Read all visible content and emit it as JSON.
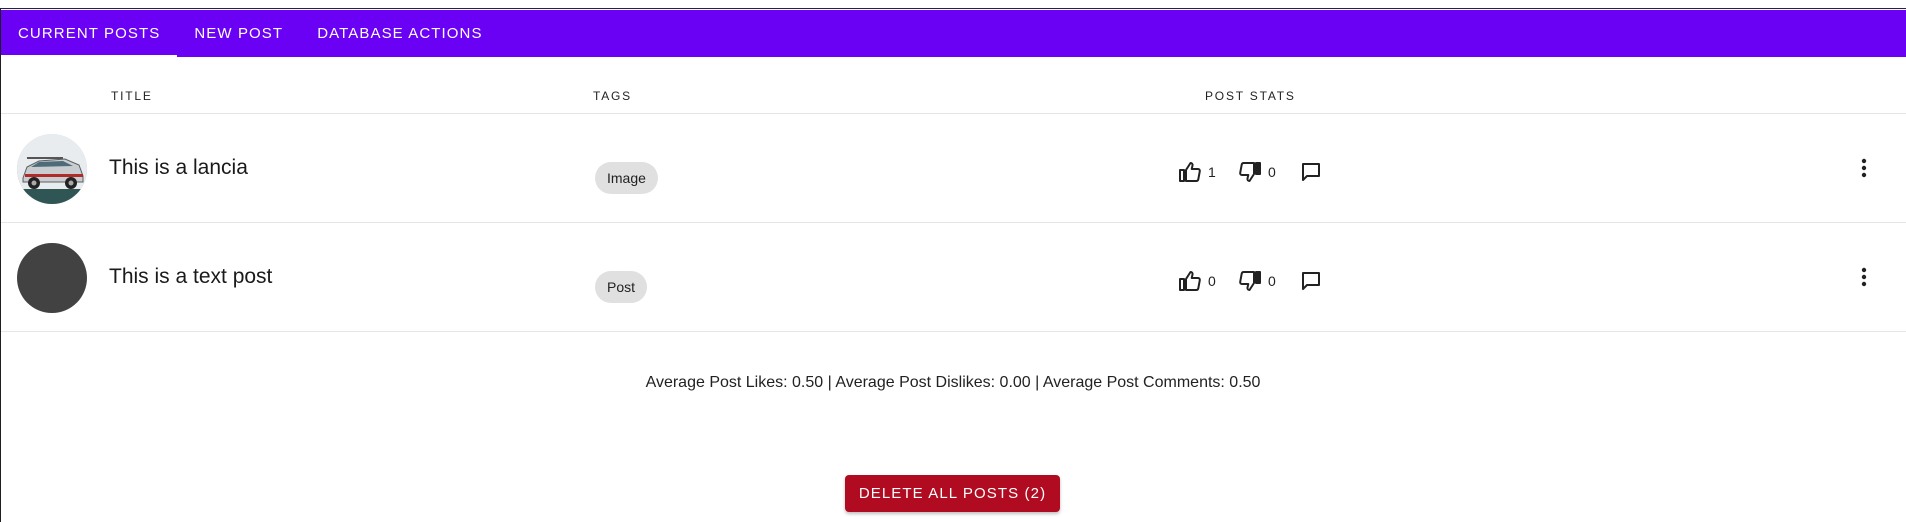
{
  "nav": {
    "tabs": [
      {
        "label": "Current Posts",
        "active": true
      },
      {
        "label": "New Post",
        "active": false
      },
      {
        "label": "Database Actions",
        "active": false
      }
    ]
  },
  "table": {
    "columns": [
      "Title",
      "Tags",
      "Post Stats"
    ],
    "rows": [
      {
        "title": "This is a lancia",
        "tag": "Image",
        "likes": "1",
        "dislikes": "0",
        "avatar": "car-photo"
      },
      {
        "title": "This is a text post",
        "tag": "Post",
        "likes": "0",
        "dislikes": "0",
        "avatar": "blank"
      }
    ]
  },
  "summary": "Average Post Likes: 0.50 | Average Post Dislikes: 0.00 | Average Post Comments: 0.50",
  "delete_button": "Delete All Posts (2)",
  "icons": {
    "like": "thumb-up-icon",
    "dislike": "thumb-down-icon",
    "comment": "comment-icon",
    "menu": "more-vert-icon"
  },
  "colors": {
    "appbar": "#6a00f4",
    "delete": "#b00b20",
    "chip": "#e0e0e0"
  }
}
